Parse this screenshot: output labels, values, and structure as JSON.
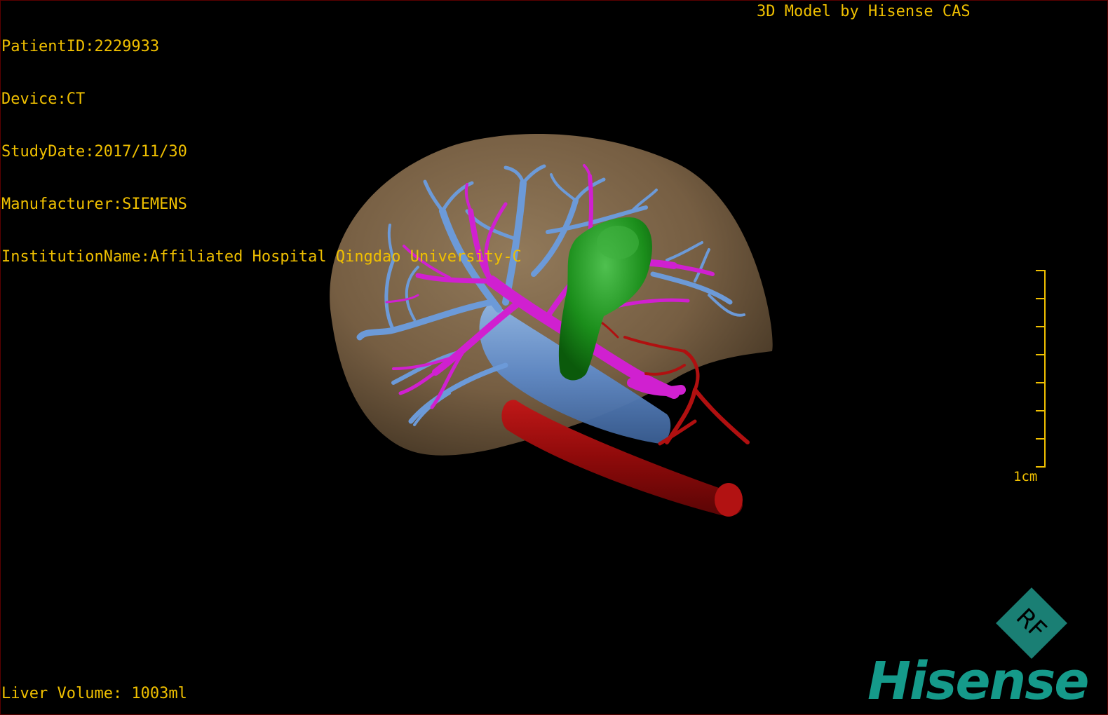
{
  "header": {
    "patient_id": "PatientID:2229933",
    "device": "Device:CT",
    "study_date": "StudyDate:2017/11/30",
    "manufacturer": "Manufacturer:SIEMENS",
    "institution": "InstitutionName:Affiliated Hospital Qingdao University-C",
    "model_credit": "3D Model by Hisense CAS"
  },
  "footer": {
    "liver_volume": "Liver Volume: 1003ml"
  },
  "scale": {
    "label": "1cm",
    "tick_count": 8
  },
  "badge": {
    "text": "RF"
  },
  "brand": {
    "name": "Hisense"
  },
  "colors": {
    "overlay_text": "#f0c000",
    "liver": "#8a6f4e",
    "portal_vein": "#d020d0",
    "hepatic_vein": "#6c9ad8",
    "tumor": "#1c8f1c",
    "artery": "#9a0c0c",
    "brand": "#159a8a"
  },
  "model": {
    "structures": [
      "liver",
      "hepatic-vein",
      "portal-vein",
      "tumor",
      "artery"
    ]
  }
}
